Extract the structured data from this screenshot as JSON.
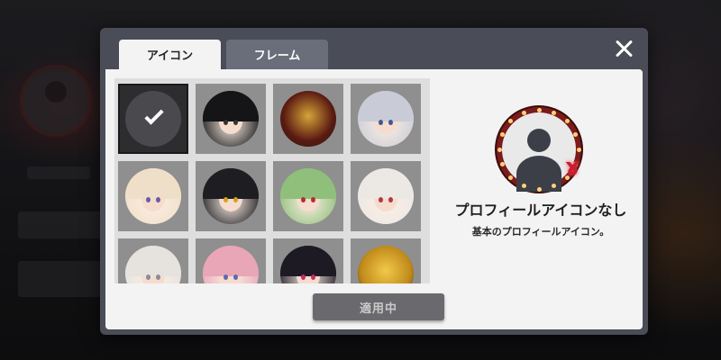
{
  "tabs": [
    {
      "label": "アイコン",
      "active": true
    },
    {
      "label": "フレーム",
      "active": false
    }
  ],
  "close_icon": "close-icon",
  "icons": [
    {
      "name": "default",
      "selected": true,
      "hair": "#4a4a4e",
      "eye": "#ffffff"
    },
    {
      "name": "black-hair-boy",
      "selected": false,
      "hair": "#151518",
      "eye": "#333333"
    },
    {
      "name": "gramophone",
      "selected": false,
      "hair": "#5a1a12",
      "eye": "#d6a438"
    },
    {
      "name": "silver-hair-boy",
      "selected": false,
      "hair": "#c9ccd6",
      "eye": "#3b5a8f"
    },
    {
      "name": "blonde-girl",
      "selected": false,
      "hair": "#f0dfc8",
      "eye": "#6b5aa8"
    },
    {
      "name": "black-yellow-girl",
      "selected": false,
      "hair": "#1d1d22",
      "eye": "#d6a020"
    },
    {
      "name": "green-hair-girl",
      "selected": false,
      "hair": "#8fbf7a",
      "eye": "#b03030"
    },
    {
      "name": "white-hair-girl",
      "selected": false,
      "hair": "#ece8e4",
      "eye": "#b03a3a"
    },
    {
      "name": "white-hair-boy",
      "selected": false,
      "hair": "#e6e2de",
      "eye": "#8a8a9a"
    },
    {
      "name": "pink-hair-girl",
      "selected": false,
      "hair": "#e8a6b6",
      "eye": "#5a6ab0"
    },
    {
      "name": "dark-hair-girl",
      "selected": false,
      "hair": "#1e1a24",
      "eye": "#c0306a"
    },
    {
      "name": "gold-coin",
      "selected": false,
      "hair": "#c08a1a",
      "eye": "#f2c84a"
    }
  ],
  "apply_button": {
    "label": "適用中"
  },
  "preview": {
    "title": "プロフィールアイコンなし",
    "description": "基本のプロフィールアイコン。"
  }
}
